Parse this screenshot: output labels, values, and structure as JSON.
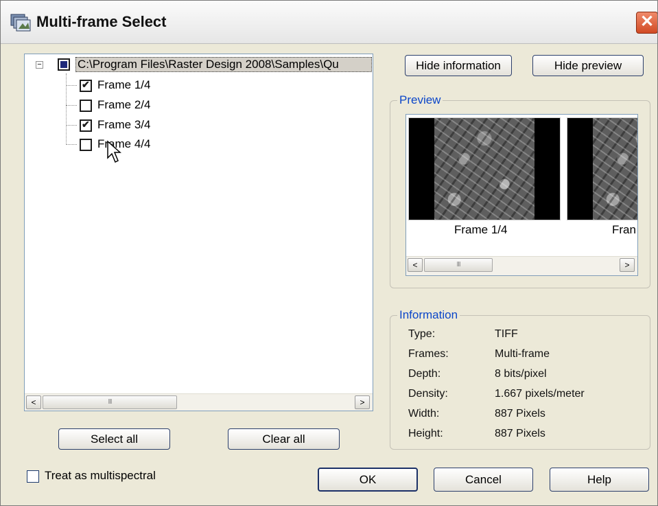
{
  "window": {
    "title": "Multi-frame Select",
    "close_glyph": "✕"
  },
  "tree": {
    "root_path": "C:\\Program Files\\Raster Design 2008\\Samples\\Qu",
    "expander_glyph": "−",
    "frames": [
      {
        "label": "Frame 1/4",
        "checked": true
      },
      {
        "label": "Frame 2/4",
        "checked": false
      },
      {
        "label": "Frame 3/4",
        "checked": true
      },
      {
        "label": "Frame 4/4",
        "checked": false
      }
    ]
  },
  "scroll": {
    "left_glyph": "<",
    "right_glyph": ">",
    "thumb_grip": "III"
  },
  "buttons": {
    "hide_information": "Hide information",
    "hide_preview": "Hide preview",
    "select_all": "Select all",
    "clear_all": "Clear all",
    "ok": "OK",
    "cancel": "Cancel",
    "help": "Help"
  },
  "preview": {
    "title": "Preview",
    "thumbnails": [
      "Frame 1/4",
      "Fran"
    ]
  },
  "information": {
    "title": "Information",
    "rows": [
      {
        "key": "Type:",
        "value": "TIFF"
      },
      {
        "key": "Frames:",
        "value": "Multi-frame"
      },
      {
        "key": "Depth:",
        "value": "8 bits/pixel"
      },
      {
        "key": "Density:",
        "value": "1.667 pixels/meter"
      },
      {
        "key": "Width:",
        "value": "887 Pixels"
      },
      {
        "key": "Height:",
        "value": "887 Pixels"
      }
    ]
  },
  "multispectral": {
    "label": "Treat as multispectral",
    "checked": false
  },
  "colors": {
    "accent": "#0b46c9",
    "close": "#d24a24",
    "dialog_bg": "#ece9d8"
  }
}
